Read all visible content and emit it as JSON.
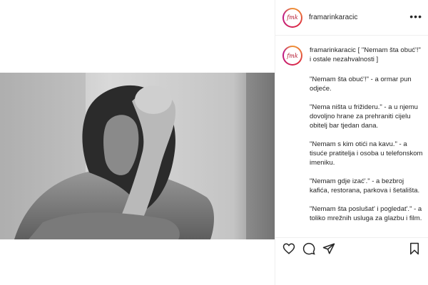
{
  "post": {
    "username": "framarinkaracic",
    "avatar_text": "fmk",
    "more_icon": "•••",
    "caption_title": "[ \"Nemam šta obuć'!\" i ostale nezahvalnosti ]",
    "paragraphs": [
      "\"Nemam šta obuć'!\" - a ormar pun odjeće.",
      "\"Nema ništa u frižideru.\" - a u njemu dovoljno hrane za prehraniti cijelu obitelj bar tjedan dana.",
      "\"Nemam s kim otići na kavu.\" - a tisuće pratitelja i osoba u telefonskom imeniku.",
      "\"Nemam gdje izać'.\" - a bezbroj kafića, restorana, parkova i šetališta.",
      "\"Nemam šta poslušat' i pogledat'.\" - a toliko mrežnih usluga za glazbu i film."
    ]
  },
  "icons": {
    "like": "heart-icon",
    "comment": "comment-icon",
    "share": "share-icon",
    "save": "bookmark-icon"
  },
  "colors": {
    "text": "#262626",
    "border": "#efefef",
    "avatar_accent": "#b0122a"
  }
}
